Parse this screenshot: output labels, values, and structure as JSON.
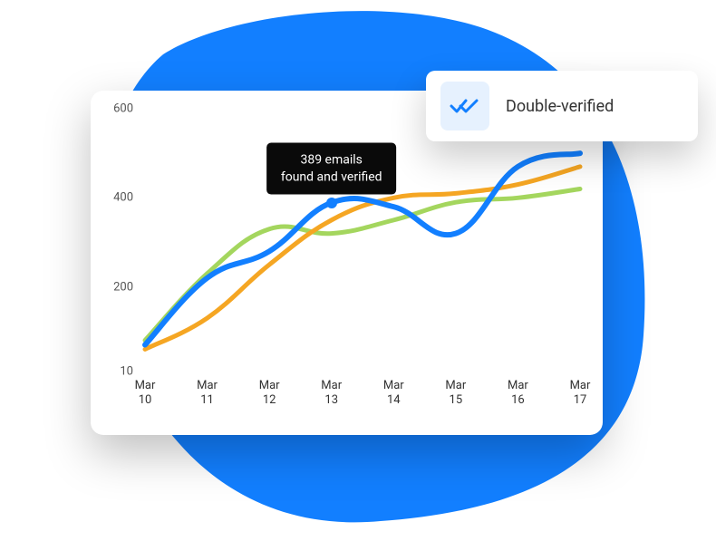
{
  "badge": {
    "label": "Double-verified",
    "icon_name": "double-check-icon"
  },
  "tooltip": {
    "line1": "389 emails",
    "line2": "found and verified",
    "category_index": 3
  },
  "colors": {
    "blue": "#127FFF",
    "orange": "#F5A623",
    "green": "#A4D65E",
    "blob": "#127FFF",
    "badge_icon_bg": "#E6F1FE"
  },
  "chart_data": {
    "type": "line",
    "categories": [
      "Mar 10",
      "Mar 11",
      "Mar 12",
      "Mar 13",
      "Mar 14",
      "Mar 15",
      "Mar 16",
      "Mar 17"
    ],
    "y_ticks": [
      10,
      200,
      400,
      600
    ],
    "ylim": [
      10,
      600
    ],
    "series": [
      {
        "name": "blue",
        "color": "#127FFF",
        "values": [
          70,
          220,
          280,
          389,
          380,
          320,
          470,
          500
        ]
      },
      {
        "name": "orange",
        "color": "#F5A623",
        "values": [
          60,
          130,
          250,
          350,
          400,
          410,
          430,
          470
        ]
      },
      {
        "name": "green",
        "color": "#A4D65E",
        "values": [
          80,
          230,
          330,
          320,
          350,
          390,
          400,
          420
        ]
      }
    ],
    "highlight": {
      "series": "blue",
      "index": 3,
      "value": 389
    }
  }
}
